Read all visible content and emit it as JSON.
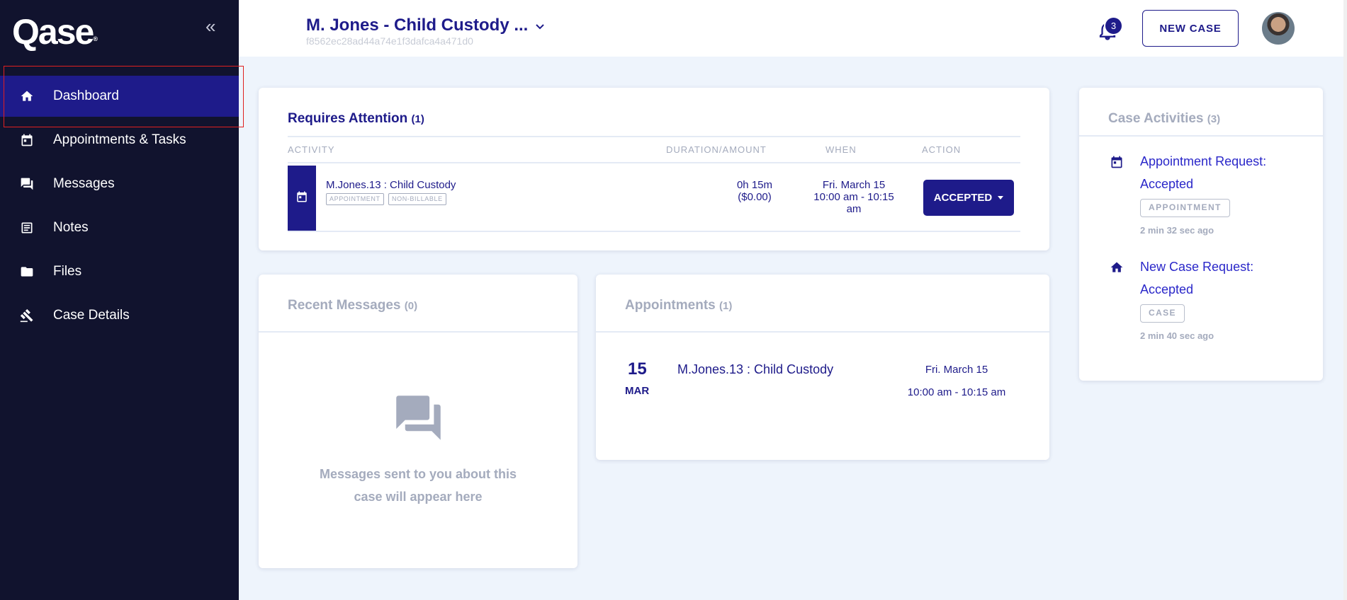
{
  "sidebar": {
    "logo": "Qase",
    "logo_mark": "®",
    "collapse_glyph": "«",
    "items": [
      {
        "label": "Dashboard",
        "icon": "home-icon",
        "active": true
      },
      {
        "label": "Appointments & Tasks",
        "icon": "calendar-icon"
      },
      {
        "label": "Messages",
        "icon": "chat-icon"
      },
      {
        "label": "Notes",
        "icon": "note-icon"
      },
      {
        "label": "Files",
        "icon": "folder-icon"
      },
      {
        "label": "Case Details",
        "icon": "gavel-icon"
      }
    ]
  },
  "header": {
    "case_title": "M. Jones - Child Custody ...",
    "case_id": "f8562ec28ad44a74e1f3dafca4a471d0",
    "notification_count": "3",
    "new_case_label": "NEW CASE"
  },
  "requires_attention": {
    "title": "Requires Attention",
    "count": "(1)",
    "columns": {
      "activity": "ACTIVITY",
      "duration": "DURATION/AMOUNT",
      "when": "WHEN",
      "action": "ACTION"
    },
    "row": {
      "name": "M.Jones.13 : Child Custody",
      "tags": [
        "APPOINTMENT",
        "NON-BILLABLE"
      ],
      "duration": "0h 15m",
      "amount": "($0.00)",
      "when_date": "Fri. March 15",
      "when_time": "10:00 am - 10:15",
      "when_time_end": "am",
      "action_label": "ACCEPTED"
    }
  },
  "recent_messages": {
    "title": "Recent Messages",
    "count": "(0)",
    "empty_line1": "Messages sent to you about this",
    "empty_line2": "case will appear here"
  },
  "appointments": {
    "title": "Appointments",
    "count": "(1)",
    "items": [
      {
        "day": "15",
        "month": "MAR",
        "name": "M.Jones.13 : Child Custody",
        "date": "Fri. March 15",
        "time": "10:00 am - 10:15 am"
      }
    ]
  },
  "case_activities": {
    "title": "Case Activities",
    "count": "(3)",
    "items": [
      {
        "icon": "calendar-icon",
        "title_line1": "Appointment Request:",
        "title_line2": "Accepted",
        "tag": "APPOINTMENT",
        "time": "2 min 32 sec ago"
      },
      {
        "icon": "home-icon",
        "title_line1": "New Case Request:",
        "title_line2": "Accepted",
        "tag": "CASE",
        "time": "2 min 40 sec ago"
      }
    ]
  },
  "colors": {
    "brand": "#1e1b8a",
    "sidebar_bg": "#11132e",
    "page_bg": "#eef4fc",
    "link": "#2a27c9",
    "muted": "#a4abbd",
    "highlight": "#e02020"
  }
}
